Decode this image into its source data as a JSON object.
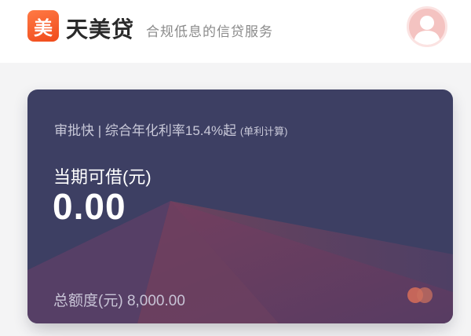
{
  "header": {
    "logo_char": "美",
    "brand": "天美贷",
    "tagline": "合规低息的信贷服务",
    "logo_color": "#f2551f"
  },
  "card": {
    "promo_main": "审批快 | 综合年化利率15.4%起",
    "promo_note": "(单利计算)",
    "available_label": "当期可借(元)",
    "available_value": "0.00",
    "total_label": "总额度(元)",
    "total_value": "8,000.00",
    "background_color": "#3d3f63"
  }
}
